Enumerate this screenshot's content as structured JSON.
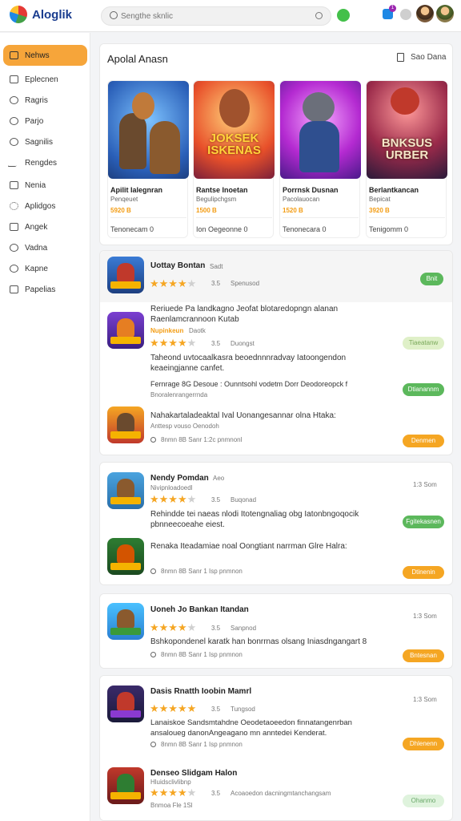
{
  "header": {
    "brand": "Aloglik",
    "search_placeholder": "Sengthe sknlic",
    "notification_count": "1"
  },
  "sidebar": {
    "items": [
      {
        "label": "Nehws",
        "icon": "home-icon",
        "active": true
      },
      {
        "label": "Eplecnen",
        "icon": "document-icon"
      },
      {
        "label": "Ragris",
        "icon": "circle-icon"
      },
      {
        "label": "Parjo",
        "icon": "globe-icon"
      },
      {
        "label": "Sagnilis",
        "icon": "target-icon"
      },
      {
        "label": "Rengdes",
        "icon": "pen-icon"
      },
      {
        "label": "Nenia",
        "icon": "box-icon"
      },
      {
        "label": "Aplidgos",
        "icon": "gear-icon"
      },
      {
        "label": "Angek",
        "icon": "list-icon"
      },
      {
        "label": "Vadna",
        "icon": "clock-icon"
      },
      {
        "label": "Kapne",
        "icon": "search-icon"
      },
      {
        "label": "Papelias",
        "icon": "grid-icon"
      }
    ]
  },
  "featured": {
    "title": "Apolal Anasn",
    "see_all": "Sao Dana",
    "cards": [
      {
        "name": "Apilit Ialegnran",
        "sub": "Penqeuet",
        "price": "5920 B",
        "meta": "Tenonecam 0",
        "overlay": ""
      },
      {
        "name": "Rantse Inoetan",
        "sub": "Begulipchgsm",
        "price": "1500 B",
        "meta": "Ion Oegeonne 0",
        "overlay": "JOKSEK ISKENAS"
      },
      {
        "name": "Porrnsk Dusnan",
        "sub": "Pacolauocan",
        "price": "1520 B",
        "meta": "Tenonecara 0",
        "overlay": ""
      },
      {
        "name": "Berlantkancan",
        "sub": "Bepicat",
        "price": "3920 B",
        "meta": "Tenigomm 0",
        "overlay": "BNKSUS URBER"
      }
    ]
  },
  "list1": {
    "items": [
      {
        "title": "Uottay Bontan",
        "tag": "Sadt",
        "rating": "3.5",
        "stars": 4,
        "meta": "Spenusod",
        "button": "Bnit",
        "btn_style": "green"
      },
      {
        "title": "Reriuede Pa landkagno Jeofat blotaredopngn alanan",
        "subtitle": "Raenlamcrannoon Kutab",
        "price_label": "Nupinkeun",
        "extra": "Daotk",
        "rating": "3.5",
        "stars": 4,
        "meta": "Duongst",
        "desc": "Taheond uvtocaalkasra beoednnnradvay Iatoongendon keaeingjanne canfet.",
        "footer": "Fernrage 8G  Desoue : Ounntsohl vodetm Dorr Deodoreopck f",
        "sub2": "Bnoralenrangerrnda",
        "button": "Tiaeatanw",
        "btn_style": "pale",
        "button2": "Dtianannm",
        "btn2_style": "green"
      },
      {
        "title": "Nahakartaladeaktal Ival Uonangesannar olna Htaka:",
        "subtitle": "Anttesp vouso Oenodoh",
        "meta": "8nmn  8B Sanr 1:2c pnmnonl",
        "button": "Denmen",
        "btn_style": "orange"
      }
    ]
  },
  "list2": {
    "items": [
      {
        "title": "Nendy Pomdan",
        "tag": "Aeo",
        "sub": "Nivipnloadoedl",
        "rating": "3.5",
        "stars": 4,
        "meta": "Buqonad",
        "time": "1:3  Som",
        "desc": "Rehindde tei naeas nlodi Itotengnaliag obg Iatonbngoqocik pbnneecoeahe eiest.",
        "button": "Fgitekasnen",
        "btn_style": "green"
      },
      {
        "title": "Renaka Iteadamiae noal Oongtiant narrman Glre Halra:",
        "meta": "8nmn  8B Sanr 1 Isp pnmnon",
        "button": "Dtinenin",
        "btn_style": "orange"
      }
    ]
  },
  "list3": {
    "items": [
      {
        "title": "Uoneh Jo Bankan Itandan",
        "rating": "3.5",
        "stars": 4,
        "meta": "Sanpnod",
        "time": "1:3  Som",
        "desc": "Bshkopondenel karatk han bonrrnas olsang Iniasdngangart 8",
        "footer": "8nmn  8B Sanr 1 Isp pnmnon",
        "button": "Bntesnan",
        "btn_style": "orange"
      }
    ]
  },
  "list4": {
    "items": [
      {
        "title": "Dasis Rnatth Ioobin Mamrl",
        "rating": "3.5",
        "stars": 5,
        "meta": "Tungsod",
        "time": "1:3  Som",
        "desc": "Lanaiskoe Sandsmtahdne Oeodetaoeedon finnatangenrban ansaloueg danonAngeagano mn anntedei Kenderat.",
        "footer": "8nmn  8B Sanr 1 Isp pnmnon",
        "button": "Dhlenenn",
        "btn_style": "orange"
      },
      {
        "title": "Denseo Slidgam Halon",
        "sub": "Hluidsclivlibnp",
        "rating": "3.5",
        "stars": 4,
        "meta": "Acoaoedon dacningmtanchangsam",
        "footer": "Bnmoa  Fle  1Sl ",
        "button": "Ohanmo",
        "btn_style": "pale2"
      }
    ]
  }
}
